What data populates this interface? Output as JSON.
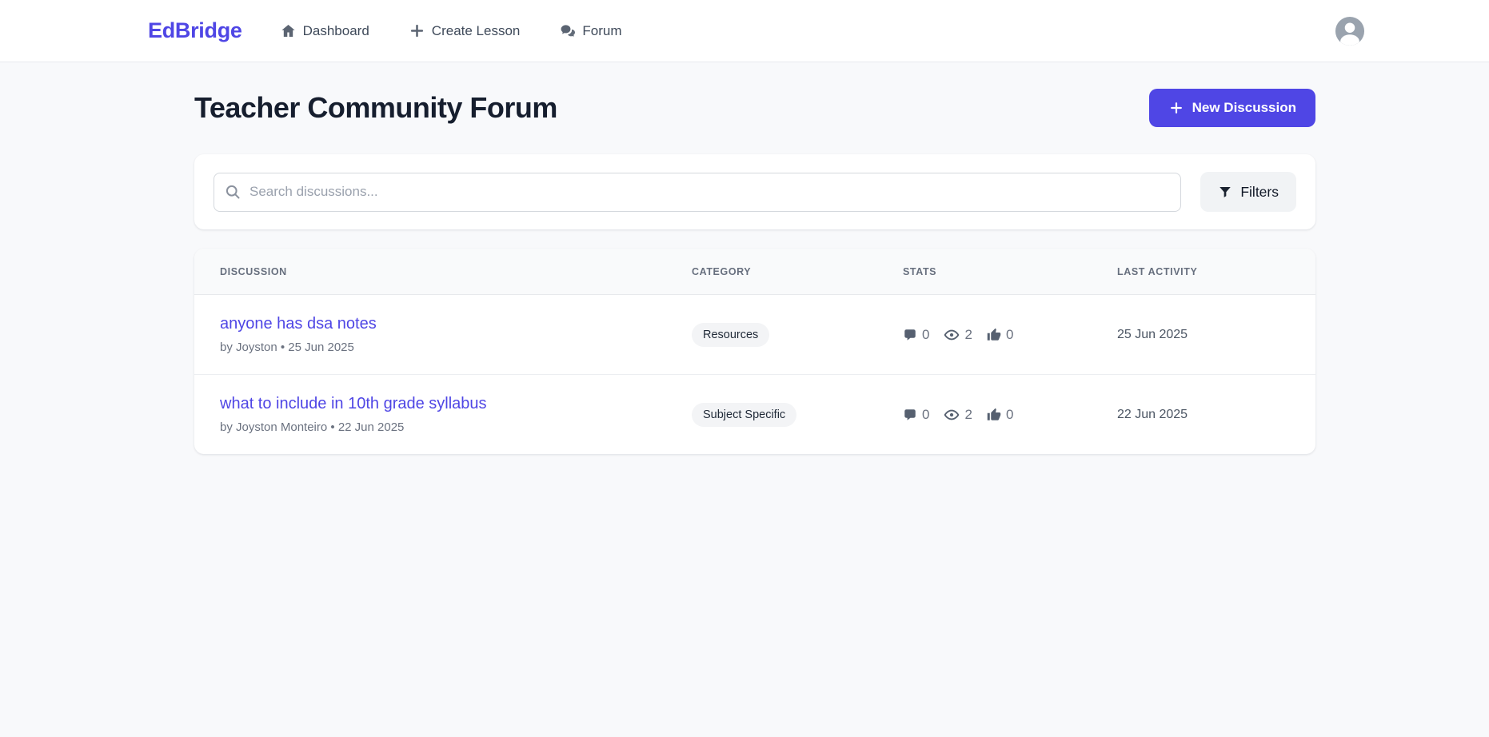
{
  "brand": {
    "name": "EdBridge",
    "color": "#4f46e5"
  },
  "nav": {
    "items": [
      {
        "label": "Dashboard",
        "icon": "home-icon"
      },
      {
        "label": "Create Lesson",
        "icon": "plus-icon"
      },
      {
        "label": "Forum",
        "icon": "chat-bubbles-icon"
      }
    ]
  },
  "page": {
    "title": "Teacher Community Forum",
    "new_discussion_label": "New Discussion"
  },
  "search": {
    "placeholder": "Search discussions...",
    "filters_label": "Filters"
  },
  "table": {
    "headers": {
      "discussion": "DISCUSSION",
      "category": "CATEGORY",
      "stats": "STATS",
      "last_activity": "LAST ACTIVITY"
    },
    "rows": [
      {
        "title": "anyone has dsa notes",
        "byline": "by Joyston • 25 Jun 2025",
        "category": "Resources",
        "comments": "0",
        "views": "2",
        "likes": "0",
        "last_activity": "25 Jun 2025"
      },
      {
        "title": "what to include in 10th grade syllabus",
        "byline": "by Joyston Monteiro • 22 Jun 2025",
        "category": "Subject Specific",
        "comments": "0",
        "views": "2",
        "likes": "0",
        "last_activity": "22 Jun 2025"
      }
    ]
  }
}
